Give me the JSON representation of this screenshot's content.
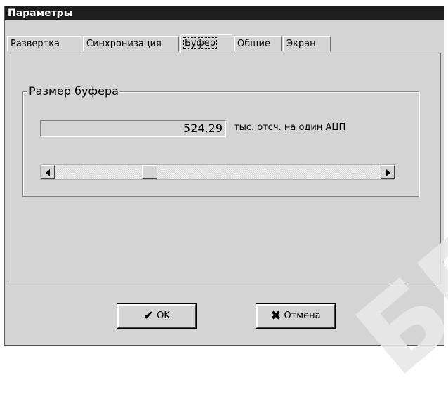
{
  "window": {
    "title": "Параметры"
  },
  "tabs": [
    {
      "label": "Развертка",
      "active": false
    },
    {
      "label": "Синхронизация",
      "active": false
    },
    {
      "label": "Буфер",
      "active": true
    },
    {
      "label": "Общие",
      "active": false
    },
    {
      "label": "Экран",
      "active": false
    }
  ],
  "buffer": {
    "group_title": "Размер буфера",
    "value": "524,29",
    "unit": "тыс. отсч. на один АЦП",
    "slider_fraction": 0.28
  },
  "buttons": {
    "ok_label": "OK",
    "cancel_label": "Отмена"
  },
  "watermark": "БГ",
  "icons": {
    "ok": "checkmark-icon",
    "cancel": "x-icon",
    "scroll_left": "arrow-left-icon",
    "scroll_right": "arrow-right-icon"
  }
}
